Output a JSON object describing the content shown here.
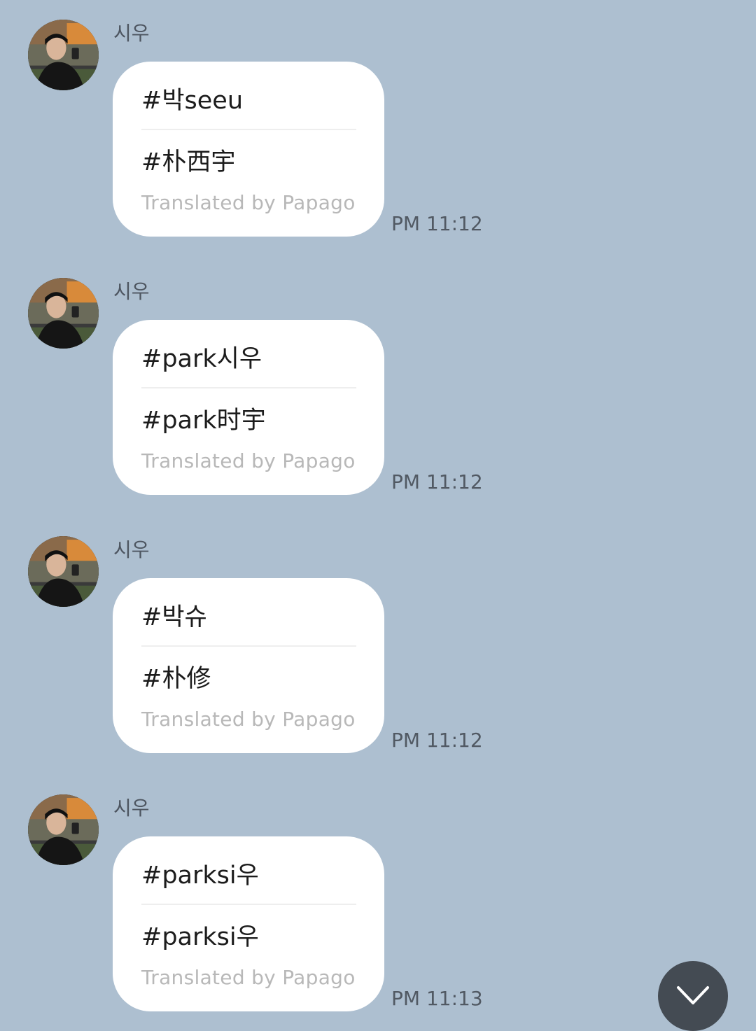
{
  "messages": [
    {
      "sender": "시우",
      "line1": "#박seeu",
      "line2": "#朴西宇",
      "credit": "Translated by Papago",
      "time": "PM 11:12"
    },
    {
      "sender": "시우",
      "line1": "#park시우",
      "line2": "#park时宇",
      "credit": "Translated by Papago",
      "time": "PM 11:12"
    },
    {
      "sender": "시우",
      "line1": "#박슈",
      "line2": "#朴修",
      "credit": "Translated by Papago",
      "time": "PM 11:12"
    },
    {
      "sender": "시우",
      "line1": "#parksi우",
      "line2": "#parksi우",
      "credit": "Translated by Papago",
      "time": "PM 11:13"
    }
  ],
  "scroll_button": {
    "icon": "chevron-down-icon"
  },
  "colors": {
    "background": "#adbfd0",
    "bubble": "#ffffff",
    "scroll_button": "#444b53"
  }
}
